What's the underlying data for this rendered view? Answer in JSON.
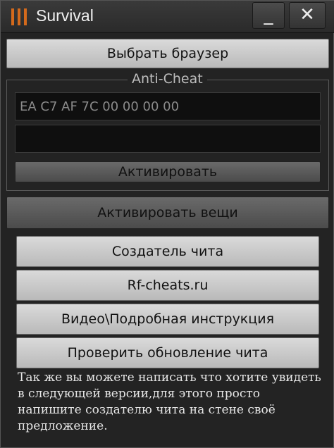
{
  "window": {
    "title": "Survival",
    "minimize_label": "_",
    "close_label": "✕"
  },
  "buttons": {
    "choose_browser": "Выбрать браузер",
    "activate": "Активировать",
    "activate_items": "Активировать вещи",
    "creator": "Создатель чита",
    "site": "Rf-cheats.ru",
    "video": "Видео\\Подробная инструкция",
    "check_update": "Проверить обновление чита"
  },
  "anticheat": {
    "label": "Anti-Cheat",
    "hex_value": "EA C7 AF 7C 00 00 00 00",
    "second_value": ""
  },
  "info_text": "Так же вы можете написать что хотите увидеть в следующей версии,для этого просто напишите создателю чита на стене своё предложение.",
  "colors": {
    "background": "#232323",
    "button": "#cfcfcf",
    "text_light": "#e6e6e6",
    "icon_accent": "#d46a1c"
  },
  "icons": {
    "app": "three-bars-icon"
  }
}
